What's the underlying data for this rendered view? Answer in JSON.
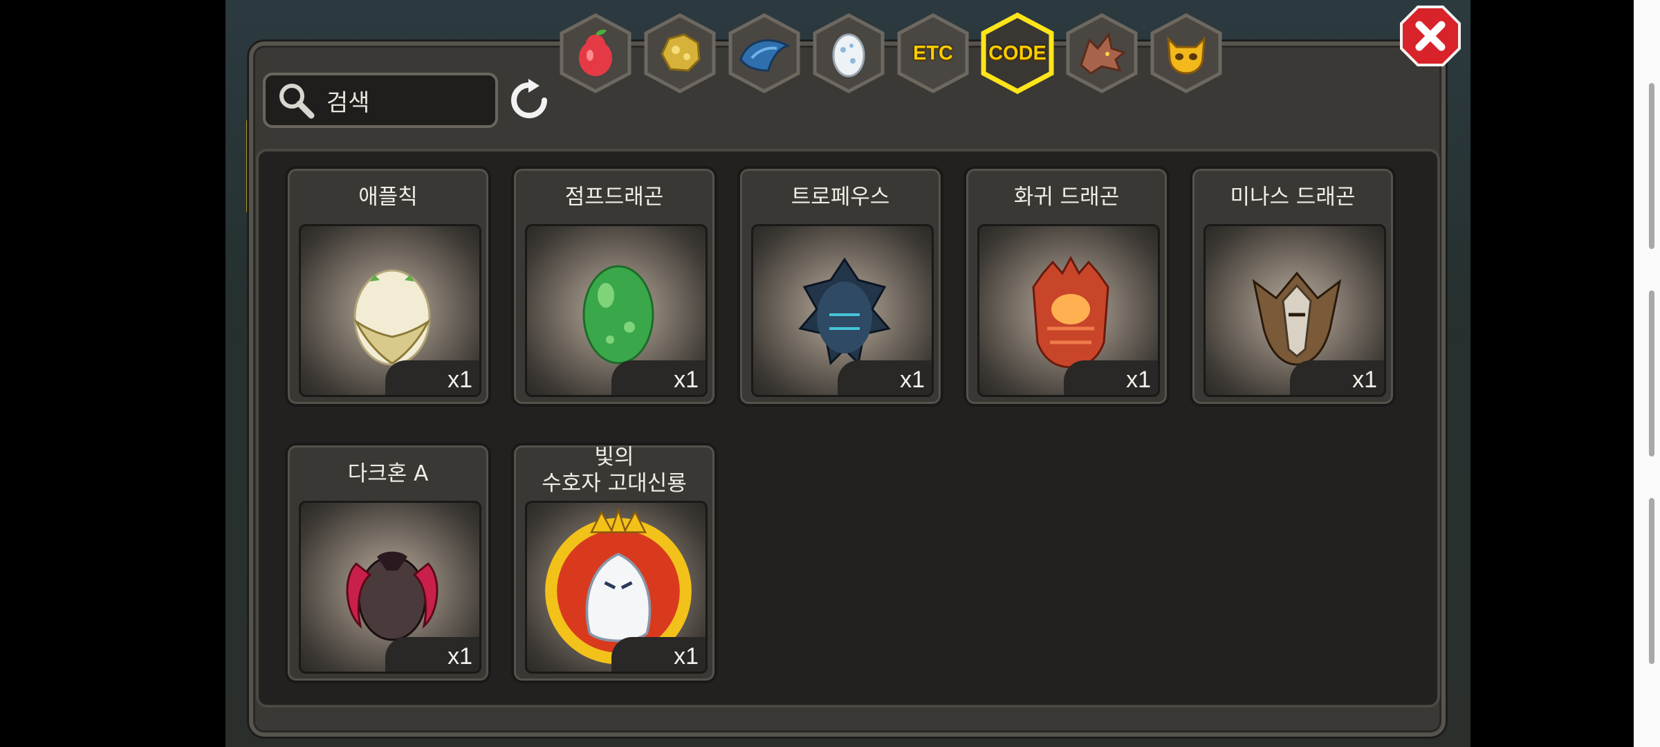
{
  "search": {
    "label": "검색"
  },
  "tabs": [
    {
      "name": "fruit",
      "icon": "pear-icon"
    },
    {
      "name": "gold",
      "icon": "gold-nugget-icon"
    },
    {
      "name": "scale",
      "icon": "blue-scale-icon"
    },
    {
      "name": "egg",
      "icon": "egg-icon"
    },
    {
      "name": "etc",
      "label": "ETC"
    },
    {
      "name": "code",
      "label": "CODE",
      "selected": true
    },
    {
      "name": "dragon",
      "icon": "dragon-head-icon"
    },
    {
      "name": "face",
      "icon": "yellow-creature-icon"
    }
  ],
  "items": [
    {
      "name": "애플칙",
      "qty": "x1",
      "icon": "winged-egg-icon"
    },
    {
      "name": "점프드래곤",
      "qty": "x1",
      "icon": "green-egg-icon"
    },
    {
      "name": "트로페우스",
      "qty": "x1",
      "icon": "dark-spiked-egg-icon"
    },
    {
      "name": "화귀 드래곤",
      "qty": "x1",
      "icon": "fire-egg-icon"
    },
    {
      "name": "미나스 드래곤",
      "qty": "x1",
      "icon": "armored-egg-icon"
    },
    {
      "name": "다크혼 A",
      "qty": "x1",
      "icon": "horned-dark-egg-icon"
    },
    {
      "name_line1": "빛의",
      "name_line2": "수호자 고대신룡",
      "qty": "x1",
      "icon": "light-guardian-dragon-icon"
    }
  ],
  "colors": {
    "accent": "#ffcc00",
    "close": "#d8232a",
    "panel": "#3b3935"
  }
}
